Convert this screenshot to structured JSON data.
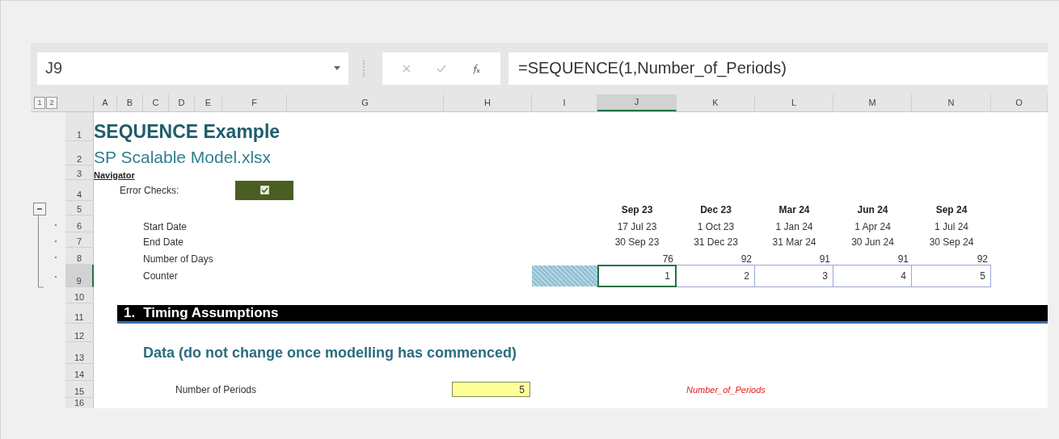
{
  "name_box": {
    "value": "J9"
  },
  "formula_bar": {
    "value": "=SEQUENCE(1,Number_of_Periods)"
  },
  "outline_levels": [
    "1",
    "2"
  ],
  "columns": [
    {
      "label": "A",
      "selected": false
    },
    {
      "label": "B",
      "selected": false
    },
    {
      "label": "C",
      "selected": false
    },
    {
      "label": "D",
      "selected": false
    },
    {
      "label": "E",
      "selected": false
    },
    {
      "label": "F",
      "selected": false
    },
    {
      "label": "G",
      "selected": false
    },
    {
      "label": "H",
      "selected": false
    },
    {
      "label": "I",
      "selected": false
    },
    {
      "label": "J",
      "selected": true
    },
    {
      "label": "K",
      "selected": false
    },
    {
      "label": "L",
      "selected": false
    },
    {
      "label": "M",
      "selected": false
    },
    {
      "label": "N",
      "selected": false
    },
    {
      "label": "O",
      "selected": false
    }
  ],
  "rows": [
    {
      "label": "1",
      "selected": false
    },
    {
      "label": "2",
      "selected": false
    },
    {
      "label": "3",
      "selected": false
    },
    {
      "label": "4",
      "selected": false
    },
    {
      "label": "5",
      "selected": false
    },
    {
      "label": "6",
      "selected": false
    },
    {
      "label": "7",
      "selected": false
    },
    {
      "label": "8",
      "selected": false
    },
    {
      "label": "9",
      "selected": true
    },
    {
      "label": "10",
      "selected": false
    },
    {
      "label": "11",
      "selected": false
    },
    {
      "label": "12",
      "selected": false
    },
    {
      "label": "13",
      "selected": false
    },
    {
      "label": "14",
      "selected": false
    },
    {
      "label": "15",
      "selected": false
    },
    {
      "label": "16",
      "selected": false
    }
  ],
  "outline_group": {
    "expanded": true
  },
  "title": "SEQUENCE Example",
  "subtitle": "SP Scalable Model.xlsx",
  "navigator": "Navigator",
  "error_checks": {
    "label": "Error Checks:",
    "checked": true
  },
  "timeline": {
    "labels": [
      "Start Date",
      "End Date",
      "Number of Days",
      "Counter"
    ],
    "periods": [
      {
        "period": "Sep 23",
        "start": "17 Jul 23",
        "end": "30 Sep 23",
        "days": "76",
        "counter": "1",
        "selected": true
      },
      {
        "period": "Dec 23",
        "start": "1 Oct 23",
        "end": "31 Dec 23",
        "days": "92",
        "counter": "2",
        "selected": false
      },
      {
        "period": "Mar 24",
        "start": "1 Jan 24",
        "end": "31 Mar 24",
        "days": "91",
        "counter": "3",
        "selected": false
      },
      {
        "period": "Jun 24",
        "start": "1 Apr 24",
        "end": "30 Jun 24",
        "days": "91",
        "counter": "4",
        "selected": false
      },
      {
        "period": "Sep 24",
        "start": "1 Jul 24",
        "end": "30 Sep 24",
        "days": "92",
        "counter": "5",
        "selected": false
      }
    ]
  },
  "section": {
    "number": "1.",
    "title": "Timing Assumptions"
  },
  "subheading": "Data (do not change once modelling has commenced)",
  "inputs": [
    {
      "label": "Number of Periods",
      "value": "5",
      "range_name": "Number_of_Periods"
    }
  ]
}
